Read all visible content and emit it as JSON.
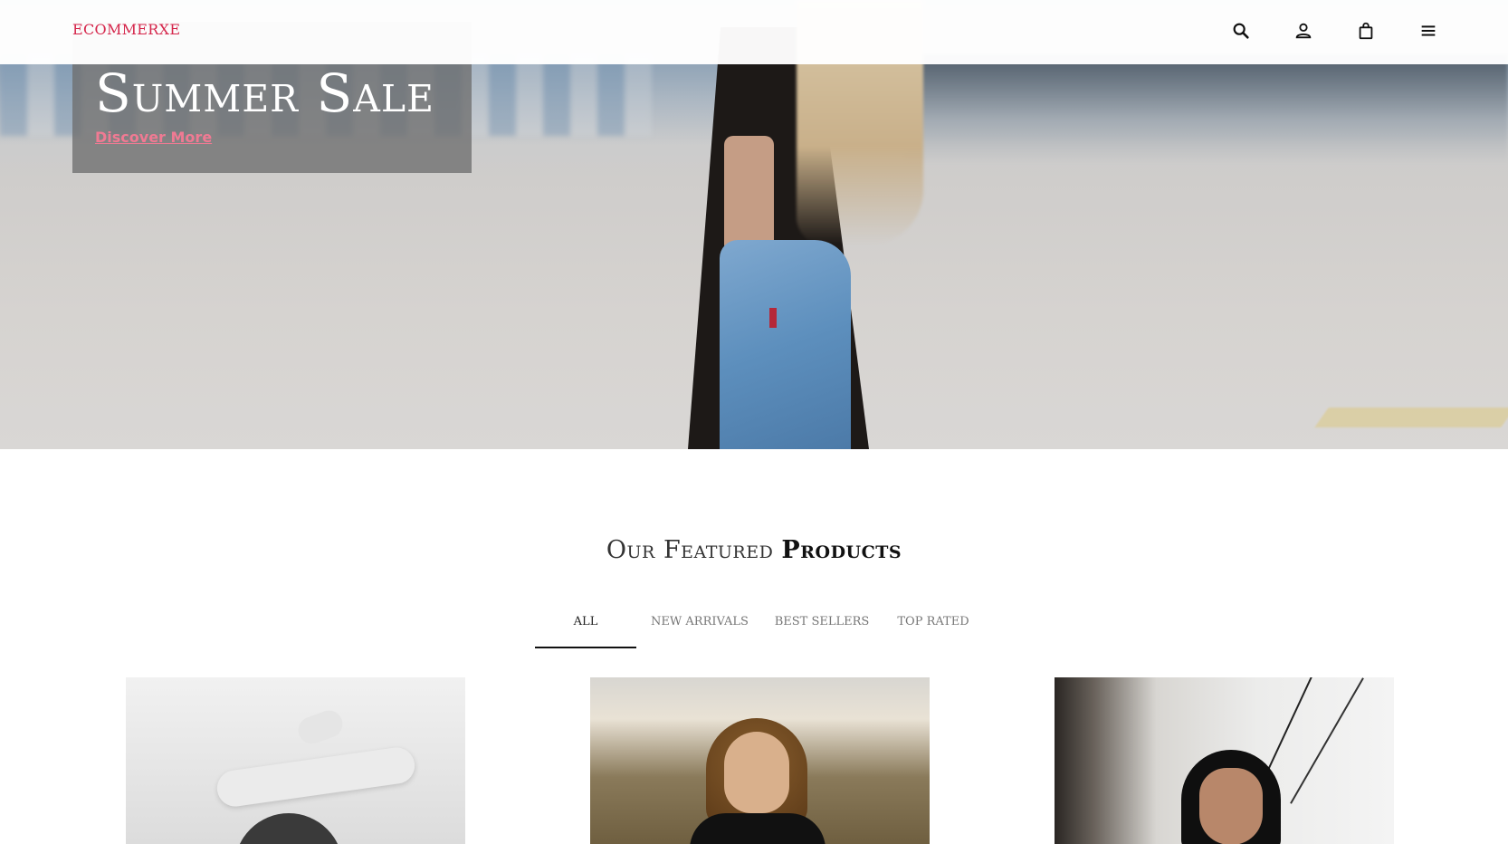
{
  "header": {
    "logo": "ECOMMERXE",
    "icons": [
      "search-icon",
      "user-icon",
      "shopping-bag-icon",
      "menu-icon"
    ]
  },
  "hero": {
    "title": "Summer Sale",
    "link_label": "Discover More"
  },
  "featured": {
    "title_light": "Our Featured",
    "title_strong": "Products",
    "tabs": [
      {
        "label": "ALL",
        "active": true
      },
      {
        "label": "NEW ARRIVALS",
        "active": false
      },
      {
        "label": "BEST SELLERS",
        "active": false
      },
      {
        "label": "TOP RATED",
        "active": false
      }
    ]
  },
  "colors": {
    "brand": "#d5264b",
    "link": "#f07a93",
    "promo_bg": "#6e6e6e"
  }
}
